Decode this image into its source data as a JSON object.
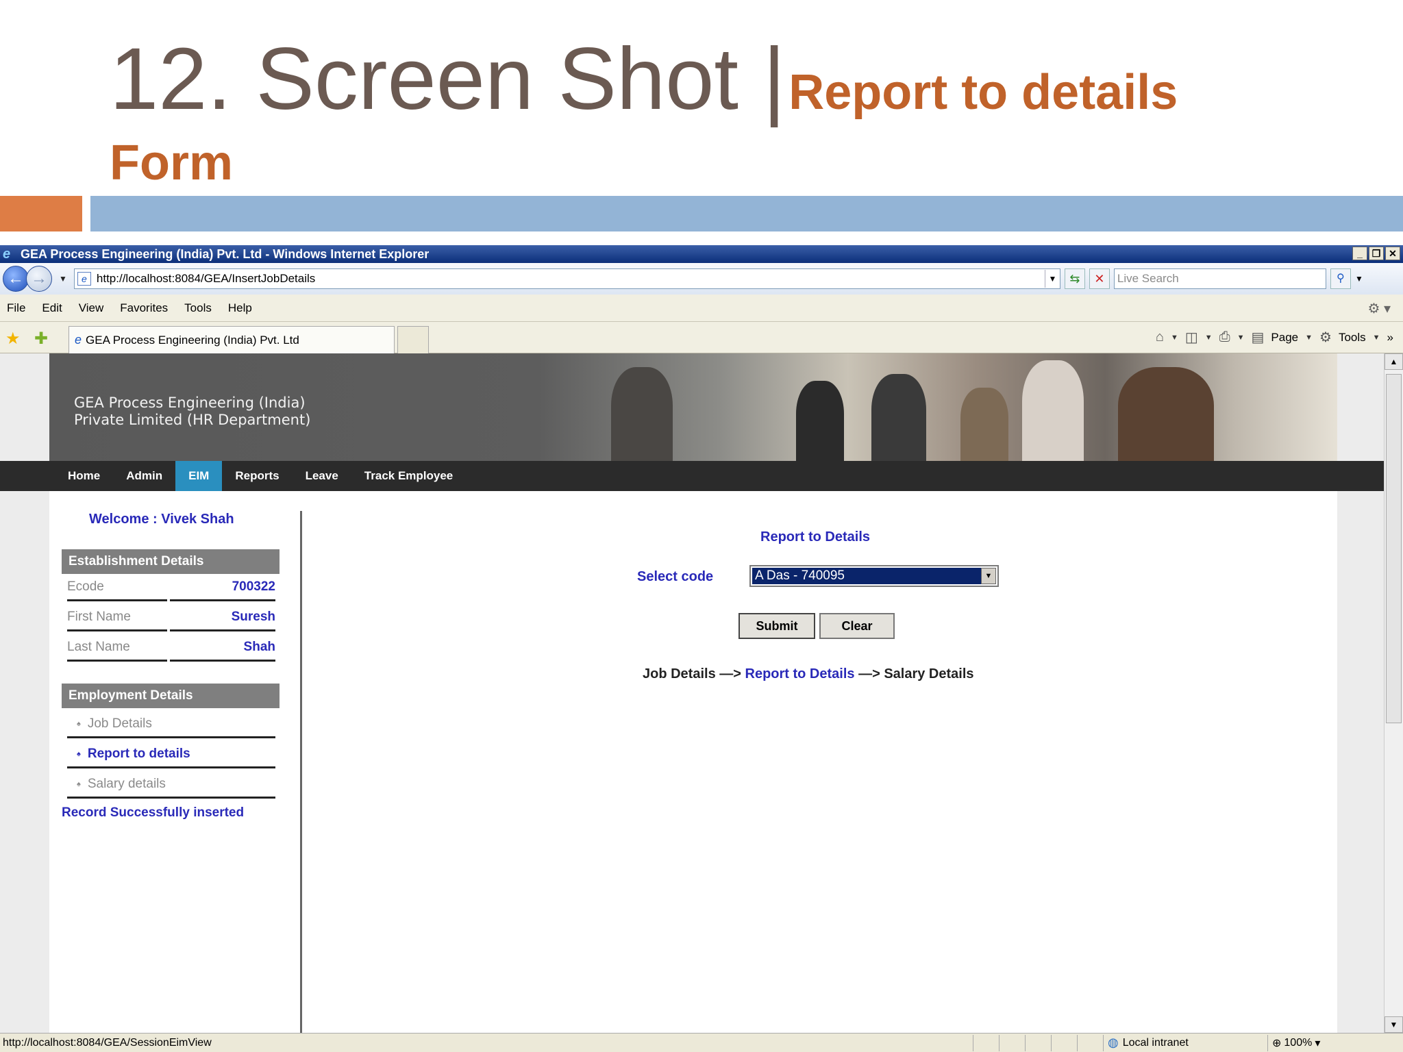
{
  "slide": {
    "title_main": "12. Screen Shot |",
    "title_sub": "Report to details",
    "title_sub2": "Form",
    "colors": {
      "title": "#6b5a52",
      "accent": "#c0622a",
      "bar_orange": "#de7d45",
      "bar_blue": "#93b4d6"
    }
  },
  "window": {
    "title": "GEA Process Engineering (India) Pvt. Ltd - Windows Internet Explorer",
    "url": "http://localhost:8084/GEA/InsertJobDetails",
    "search_placeholder": "Live Search",
    "menu": [
      "File",
      "Edit",
      "View",
      "Favorites",
      "Tools",
      "Help"
    ],
    "tab_title": "GEA Process Engineering (India) Pvt. Ltd",
    "command_bar": {
      "page_label": "Page",
      "tools_label": "Tools"
    },
    "status_text": "http://localhost:8084/GEA/SessionEimView",
    "zone": "Local intranet",
    "zoom": "100%"
  },
  "site": {
    "org_line1": "GEA Process Engineering (India)",
    "org_line2": "Private Limited (HR Department)",
    "nav": [
      "Home",
      "Admin",
      "EIM",
      "Reports",
      "Leave",
      "Track Employee"
    ],
    "nav_active": "EIM"
  },
  "sidebar": {
    "welcome": "Welcome :  Vivek Shah",
    "establishment_header": "Establishment Details",
    "fields": [
      {
        "label": "Ecode",
        "value": "700322"
      },
      {
        "label": "First Name",
        "value": "Suresh"
      },
      {
        "label": "Last Name",
        "value": "Shah"
      }
    ],
    "employment_header": "Employment Details",
    "links": [
      {
        "label": "Job Details"
      },
      {
        "label": "Report to details"
      },
      {
        "label": "Salary details"
      }
    ],
    "success_message": "Record Successfully inserted"
  },
  "form": {
    "title": "Report to Details",
    "select_label": "Select code",
    "select_value": "A Das - 740095",
    "submit_label": "Submit",
    "clear_label": "Clear",
    "breadcrumb": {
      "step1": "Job Details",
      "arrow": " —> ",
      "step2": "Report to Details",
      "step3": "Salary Details"
    }
  }
}
